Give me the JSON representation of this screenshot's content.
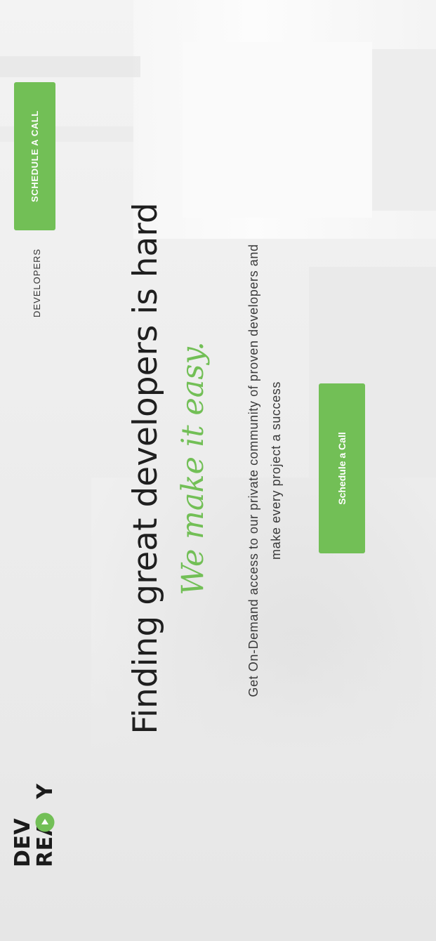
{
  "brand": {
    "logo_line1": "DEV",
    "logo_line2": "REA",
    "logo_line2_end": "Y",
    "accent_color": "#72bf56",
    "logo_icon": "play-icon"
  },
  "nav": {
    "developers_label": "DEVELOPERS",
    "cta_label": "SCHEDULE A CALL"
  },
  "hero": {
    "headline": "Finding great developers is hard",
    "tagline": "We make it easy.",
    "description": "Get On-Demand access to our private community of proven developers and make every project a success",
    "cta_label": "Schedule a Call"
  }
}
